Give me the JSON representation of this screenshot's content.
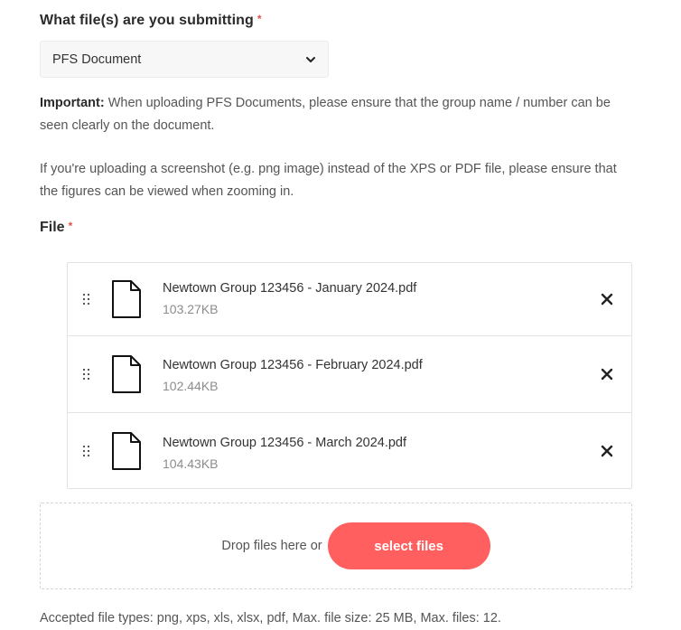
{
  "question": {
    "label": "What file(s) are you submitting",
    "required_mark": "*"
  },
  "file_type_select": {
    "selected": "PFS Document"
  },
  "notes": {
    "important_label": "Important:",
    "important_text": " When uploading PFS Documents, please ensure that the group name / number can be seen clearly on the document.",
    "screenshot_text": "If you're uploading a screenshot (e.g. png image) instead of the XPS or PDF file, please ensure that the figures can be viewed when zooming in."
  },
  "file_field": {
    "label": "File",
    "required_mark": "*"
  },
  "files": [
    {
      "name": "Newtown Group 123456 - January 2024.pdf",
      "size": "103.27KB"
    },
    {
      "name": "Newtown Group 123456 - February 2024.pdf",
      "size": "102.44KB"
    },
    {
      "name": "Newtown Group 123456 - March 2024.pdf",
      "size": "104.43KB"
    }
  ],
  "dropzone": {
    "text": "Drop files here or",
    "button_label": "select files"
  },
  "accepted_text": "Accepted file types: png, xps, xls, xlsx, pdf, Max. file size: 25 MB, Max. files: 12.",
  "colors": {
    "accent": "#ff5f5f",
    "required": "#e04f4f"
  },
  "icons": {
    "drag": "drag-handle-icon",
    "file": "document-icon",
    "remove": "close-icon",
    "dropdown": "chevron-down-icon"
  }
}
